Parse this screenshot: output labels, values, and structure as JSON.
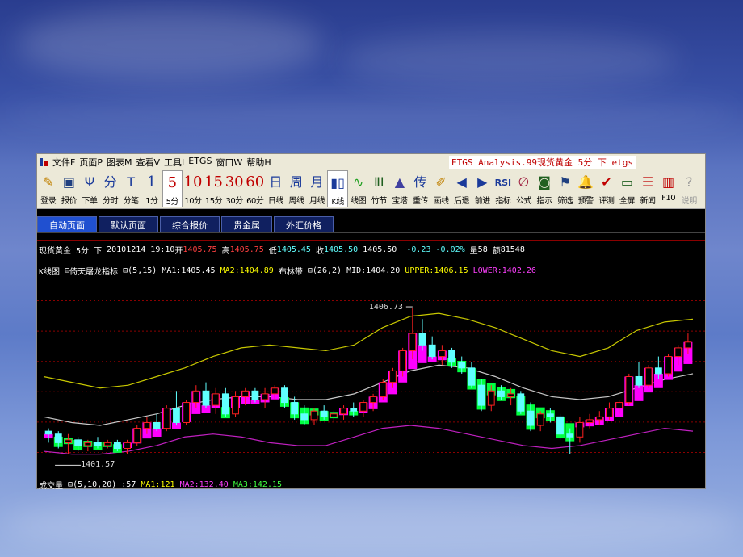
{
  "window": {
    "title": "ETGS Analysis.99现货黄金 5分 下 etgs"
  },
  "menu": [
    {
      "label": "文件F",
      "name": "menu-file"
    },
    {
      "label": "页面P",
      "name": "menu-page"
    },
    {
      "label": "图表M",
      "name": "menu-chart"
    },
    {
      "label": "查看V",
      "name": "menu-view"
    },
    {
      "label": "工具I",
      "name": "menu-tools"
    },
    {
      "label": "ETGS",
      "name": "menu-etgs"
    },
    {
      "label": "窗口W",
      "name": "menu-window"
    },
    {
      "label": "帮助H",
      "name": "menu-help"
    }
  ],
  "toolbar": [
    {
      "icon": "✎",
      "label": "登录",
      "name": "login",
      "icon_name": "pencil-icon",
      "color": "#c08000"
    },
    {
      "icon": "▣",
      "label": "报价",
      "name": "quote",
      "icon_name": "quote-icon",
      "color": "#204080"
    },
    {
      "icon": "Ψ",
      "label": "下单",
      "name": "order",
      "icon_name": "order-icon",
      "color": "#1a3a9a"
    },
    {
      "icon": "分",
      "label": "分时",
      "name": "timeshare",
      "icon_name": "timeshare-icon",
      "color": "#1a3a9a"
    },
    {
      "icon": "T",
      "label": "分笔",
      "name": "tick",
      "icon_name": "tick-icon",
      "color": "#1a3a9a"
    },
    {
      "icon": "1",
      "label": "1分",
      "name": "1min",
      "icon_name": "1min-icon",
      "color": "#1a3a9a",
      "num": true
    },
    {
      "icon": "5",
      "label": "5分",
      "name": "5min",
      "icon_name": "5min-icon",
      "color": "#c00000",
      "num": true,
      "active": true
    },
    {
      "icon": "10",
      "label": "10分",
      "name": "10min",
      "icon_name": "10min-icon",
      "color": "#c00000",
      "num": true
    },
    {
      "icon": "15",
      "label": "15分",
      "name": "15min",
      "icon_name": "15min-icon",
      "color": "#c00000",
      "num": true
    },
    {
      "icon": "30",
      "label": "30分",
      "name": "30min",
      "icon_name": "30min-icon",
      "color": "#c00000",
      "num": true
    },
    {
      "icon": "60",
      "label": "60分",
      "name": "60min",
      "icon_name": "60min-icon",
      "color": "#c00000",
      "num": true
    },
    {
      "icon": "日",
      "label": "日线",
      "name": "daily",
      "icon_name": "daily-icon",
      "color": "#1a3a9a"
    },
    {
      "icon": "周",
      "label": "周线",
      "name": "weekly",
      "icon_name": "weekly-icon",
      "color": "#1a3a9a"
    },
    {
      "icon": "月",
      "label": "月线",
      "name": "monthly",
      "icon_name": "monthly-icon",
      "color": "#1a3a9a"
    },
    {
      "icon": "▮▯",
      "label": "K线",
      "name": "kline",
      "icon_name": "kline-icon",
      "color": "#1a3a9a",
      "active": true
    },
    {
      "icon": "∿",
      "label": "线图",
      "name": "linechart",
      "icon_name": "linechart-icon",
      "color": "#20a020"
    },
    {
      "icon": "ⅡⅠ",
      "label": "竹节",
      "name": "bamboo",
      "icon_name": "bamboo-icon",
      "color": "#206020"
    },
    {
      "icon": "▲",
      "label": "宝塔",
      "name": "tower",
      "icon_name": "tower-icon",
      "color": "#4040a0"
    },
    {
      "icon": "传",
      "label": "重传",
      "name": "reload",
      "icon_name": "reload-icon",
      "color": "#1a3a9a"
    },
    {
      "icon": "✐",
      "label": "画线",
      "name": "draw",
      "icon_name": "draw-icon",
      "color": "#c08000"
    },
    {
      "icon": "◀",
      "label": "后退",
      "name": "back",
      "icon_name": "back-arrow-icon",
      "color": "#1a3a9a"
    },
    {
      "icon": "▶",
      "label": "前进",
      "name": "forward",
      "icon_name": "forward-arrow-icon",
      "color": "#1a3a9a"
    },
    {
      "icon": "RSI",
      "label": "指标",
      "name": "indicator",
      "icon_name": "rsi-icon",
      "color": "#1a3a9a"
    },
    {
      "icon": "∅",
      "label": "公式",
      "name": "formula",
      "icon_name": "formula-icon",
      "color": "#a02040"
    },
    {
      "icon": "◙",
      "label": "指示",
      "name": "indicate",
      "icon_name": "indicate-icon",
      "color": "#206020"
    },
    {
      "icon": "⚑",
      "label": "筛选",
      "name": "filter",
      "icon_name": "filter-icon",
      "color": "#204080"
    },
    {
      "icon": "🔔",
      "label": "预警",
      "name": "alert",
      "icon_name": "bell-icon",
      "color": "#c08000"
    },
    {
      "icon": "✔",
      "label": "评测",
      "name": "evaluate",
      "icon_name": "evaluate-icon",
      "color": "#c00000"
    },
    {
      "icon": "▭",
      "label": "全屏",
      "name": "fullscreen",
      "icon_name": "fullscreen-icon",
      "color": "#206020"
    },
    {
      "icon": "☰",
      "label": "新闻",
      "name": "news",
      "icon_name": "news-icon",
      "color": "#c00000"
    },
    {
      "icon": "▥",
      "label": "F10",
      "name": "f10",
      "icon_name": "f10-icon",
      "color": "#c00000"
    },
    {
      "icon": "?",
      "label": "说明",
      "name": "help",
      "icon_name": "help-icon",
      "color": "#999999",
      "dim": true
    }
  ],
  "tabs": [
    {
      "label": "自动页面",
      "active": true
    },
    {
      "label": "默认页面"
    },
    {
      "label": "综合报价"
    },
    {
      "label": "贵金属"
    },
    {
      "label": "外汇价格"
    }
  ],
  "info": {
    "symbol": "现货黄金",
    "period": "5分",
    "direction": "下",
    "datetime": "20101214 19:10",
    "open_label": "开",
    "open": "1405.75",
    "high_label": "高",
    "high": "1405.75",
    "low_label": "低",
    "low": "1405.45",
    "close_label": "收",
    "close": "1405.50",
    "last": "1405.50",
    "change": "-0.23",
    "change_pct": "-0.02%",
    "vol_label": "量",
    "vol": "58",
    "amt_label": "额",
    "amt": "81548"
  },
  "indicators": {
    "kline_label": "K线图",
    "main_ind": "倚天屠龙指标",
    "main_params": "(5,15)",
    "ma1": "MA1:1405.45",
    "ma2": "MA2:1404.89",
    "boll_label": "布林带",
    "boll_params": "(26,2)",
    "mid": "MID:1404.20",
    "upper": "UPPER:1406.15",
    "lower": "LOWER:1402.26"
  },
  "volume": {
    "label": "成交量",
    "params": "(5,10,20)",
    "value": ":57",
    "ma1": "MA1:121",
    "ma2": "MA2:132.40",
    "ma3": "MA3:142.15"
  },
  "chart_data": {
    "type": "candlestick",
    "high_label": "1406.73",
    "low_label": "1401.57",
    "ylim": [
      1401.0,
      1407.6
    ],
    "candles": [
      [
        1402.4,
        1402.5,
        1402.0,
        1402.3
      ],
      [
        1402.3,
        1402.4,
        1401.8,
        1402.0
      ],
      [
        1402.0,
        1402.3,
        1401.6,
        1402.1
      ],
      [
        1402.1,
        1402.2,
        1401.7,
        1401.9
      ],
      [
        1401.9,
        1402.1,
        1401.7,
        1402.0
      ],
      [
        1402.0,
        1402.2,
        1401.8,
        1401.9
      ],
      [
        1401.9,
        1402.1,
        1401.8,
        1402.0
      ],
      [
        1402.0,
        1402.1,
        1401.7,
        1401.8
      ],
      [
        1401.8,
        1402.1,
        1401.6,
        1402.0
      ],
      [
        1402.0,
        1402.6,
        1401.9,
        1402.5
      ],
      [
        1402.5,
        1402.9,
        1402.3,
        1402.7
      ],
      [
        1402.7,
        1403.0,
        1402.4,
        1402.5
      ],
      [
        1402.5,
        1403.3,
        1402.4,
        1403.2
      ],
      [
        1403.2,
        1403.8,
        1402.6,
        1402.7
      ],
      [
        1402.7,
        1403.5,
        1402.6,
        1403.4
      ],
      [
        1403.4,
        1404.0,
        1403.2,
        1403.8
      ],
      [
        1403.8,
        1404.1,
        1403.2,
        1403.3
      ],
      [
        1403.3,
        1403.9,
        1403.0,
        1403.7
      ],
      [
        1403.7,
        1403.9,
        1402.9,
        1403.0
      ],
      [
        1403.0,
        1403.8,
        1402.9,
        1403.6
      ],
      [
        1403.6,
        1403.9,
        1403.3,
        1403.8
      ],
      [
        1403.8,
        1403.9,
        1403.4,
        1403.5
      ],
      [
        1403.5,
        1403.9,
        1403.2,
        1403.7
      ],
      [
        1403.7,
        1404.0,
        1403.5,
        1403.9
      ],
      [
        1403.9,
        1404.0,
        1403.2,
        1403.4
      ],
      [
        1403.4,
        1403.6,
        1402.8,
        1403.0
      ],
      [
        1403.0,
        1403.3,
        1402.6,
        1402.8
      ],
      [
        1402.8,
        1403.2,
        1402.6,
        1403.1
      ],
      [
        1403.1,
        1403.3,
        1402.8,
        1402.9
      ],
      [
        1402.9,
        1403.1,
        1402.7,
        1403.0
      ],
      [
        1403.0,
        1403.3,
        1402.8,
        1403.2
      ],
      [
        1403.2,
        1403.4,
        1402.9,
        1403.1
      ],
      [
        1403.1,
        1403.5,
        1402.9,
        1403.4
      ],
      [
        1403.4,
        1403.7,
        1403.1,
        1403.6
      ],
      [
        1403.6,
        1404.2,
        1403.5,
        1404.1
      ],
      [
        1404.1,
        1404.6,
        1403.9,
        1404.5
      ],
      [
        1404.5,
        1405.3,
        1404.3,
        1405.2
      ],
      [
        1405.2,
        1406.7,
        1404.9,
        1405.8
      ],
      [
        1405.8,
        1406.3,
        1405.2,
        1405.4
      ],
      [
        1405.4,
        1405.7,
        1404.9,
        1405.0
      ],
      [
        1405.0,
        1405.4,
        1404.7,
        1405.2
      ],
      [
        1405.2,
        1405.3,
        1404.6,
        1404.8
      ],
      [
        1404.8,
        1405.0,
        1404.4,
        1404.6
      ],
      [
        1404.6,
        1404.8,
        1403.9,
        1404.0
      ],
      [
        1404.0,
        1404.2,
        1403.1,
        1403.3
      ],
      [
        1403.3,
        1404.0,
        1403.1,
        1403.8
      ],
      [
        1403.8,
        1404.0,
        1403.5,
        1403.6
      ],
      [
        1403.6,
        1403.9,
        1403.3,
        1403.7
      ],
      [
        1403.7,
        1403.8,
        1403.0,
        1403.1
      ],
      [
        1403.1,
        1403.4,
        1402.4,
        1402.6
      ],
      [
        1402.6,
        1403.1,
        1402.4,
        1403.0
      ],
      [
        1403.0,
        1403.2,
        1402.7,
        1402.9
      ],
      [
        1402.9,
        1403.0,
        1402.1,
        1402.3
      ],
      [
        1402.3,
        1402.5,
        1401.6,
        1402.2
      ],
      [
        1402.2,
        1402.9,
        1402.0,
        1402.7
      ],
      [
        1402.7,
        1403.0,
        1402.5,
        1402.8
      ],
      [
        1402.8,
        1403.1,
        1402.6,
        1402.9
      ],
      [
        1402.9,
        1403.4,
        1402.8,
        1403.2
      ],
      [
        1403.2,
        1403.5,
        1403.0,
        1403.4
      ],
      [
        1403.4,
        1404.4,
        1403.3,
        1404.3
      ],
      [
        1404.3,
        1404.8,
        1403.9,
        1404.0
      ],
      [
        1404.0,
        1404.7,
        1403.9,
        1404.6
      ],
      [
        1404.6,
        1405.0,
        1404.2,
        1404.4
      ],
      [
        1404.4,
        1405.1,
        1404.3,
        1405.0
      ],
      [
        1405.0,
        1405.4,
        1404.7,
        1405.3
      ],
      [
        1405.3,
        1405.8,
        1405.1,
        1405.5
      ]
    ],
    "upper": [
      1404.3,
      1404.1,
      1403.9,
      1404.0,
      1404.3,
      1404.6,
      1405.0,
      1405.3,
      1405.4,
      1405.3,
      1405.2,
      1405.4,
      1406.0,
      1406.4,
      1406.5,
      1406.3,
      1406.0,
      1405.6,
      1405.2,
      1405.0,
      1405.3,
      1405.9,
      1406.2,
      1406.3
    ],
    "mid": [
      1402.9,
      1402.7,
      1402.6,
      1402.8,
      1403.0,
      1403.3,
      1403.5,
      1403.6,
      1403.6,
      1403.5,
      1403.5,
      1403.7,
      1404.1,
      1404.5,
      1404.7,
      1404.6,
      1404.3,
      1403.9,
      1403.6,
      1403.5,
      1403.6,
      1403.9,
      1404.2,
      1404.4
    ],
    "lower": [
      1401.7,
      1401.6,
      1401.6,
      1401.7,
      1401.9,
      1402.2,
      1402.3,
      1402.2,
      1402.0,
      1401.9,
      1401.9,
      1402.2,
      1402.5,
      1402.6,
      1402.5,
      1402.3,
      1402.1,
      1401.9,
      1401.8,
      1401.9,
      1402.1,
      1402.3,
      1402.5,
      1402.4
    ]
  },
  "colors": {
    "up": "#ff2020",
    "down": "#60ffff",
    "band_up": "#ff00ff",
    "band_down": "#00ff40",
    "upper": "#c8c800",
    "mid": "#c8c8c8",
    "lower": "#c020c0",
    "grid": "#8b0000"
  }
}
